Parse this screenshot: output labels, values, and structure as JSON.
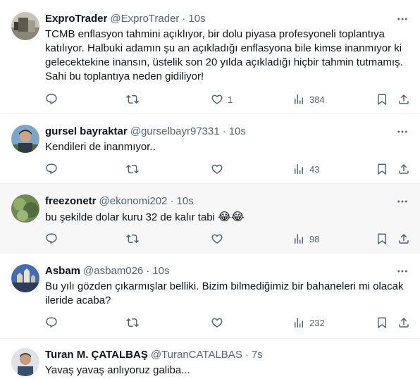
{
  "tweets": [
    {
      "name": "ExproTrader",
      "handle": "@ExproTrader",
      "time": "10s",
      "text": "TCMB enflasyon tahmini açıklıyor, bir dolu piyasa profesyoneli toplantıya katılıyor. Halbuki adamın şu an açıkladığı enflasyona bile kimse inanmıyor ki gelecektekine inansın, üstelik son 20 yılda açıkladığı hiçbir tahmin tutmamış. Sahi bu toplantıya neden gidiliyor!",
      "likes": "1",
      "views": "384"
    },
    {
      "name": "gursel bayraktar",
      "handle": "@gurselbayr97331",
      "time": "10s",
      "text": "Kendileri de inanmıyor..",
      "views": "43"
    },
    {
      "name": "freezonetr",
      "handle": "@ekonomi202",
      "time": "10s",
      "text": "bu şekilde dolar kuru 32 de kalır tabi",
      "emoji": "😂😂",
      "views": "98"
    },
    {
      "name": "Asbam",
      "handle": "@asbam026",
      "time": "10s",
      "text": "Bu yılı gözden çıkarmışlar belliki. Bizim bilmediğimiz bir bahaneleri mi olacak ileride acaba?",
      "views": "232"
    },
    {
      "name": "Turan M. ÇATALBAŞ",
      "handle": "@TuranCATALBAS",
      "time": "7s",
      "text": "Yavaş yavaş anlıyoruz galiba..."
    }
  ],
  "separator": "·",
  "icons": [
    "more-icon",
    "reply-icon",
    "retweet-icon",
    "like-icon",
    "views-icon",
    "bookmark-icon",
    "share-icon"
  ],
  "colors": {
    "text": "#0f1419",
    "secondary": "#536471",
    "border": "#eff3f4",
    "hover_bg": "#f7f7f7"
  }
}
